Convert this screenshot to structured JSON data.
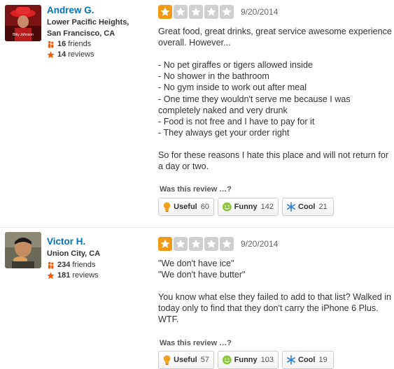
{
  "reviews": [
    {
      "user": {
        "name": "Andrew G.",
        "location": "Lower Pacific Heights, San Francisco, CA",
        "friends": "16",
        "friends_label": "friends",
        "reviews": "14",
        "reviews_label": "reviews",
        "avatar_text": "Biky Johnson"
      },
      "rating": 1,
      "date": "9/20/2014",
      "text": "Great food, great drinks, great service awesome experience overall. However...\n\n- No pet giraffes or tigers allowed inside\n- No shower in the bathroom\n- No gym inside to work out after meal\n- One time they wouldn't serve me because I was completely naked and very drunk\n- Food is not free and I have to pay for it\n- They always get your order right\n\nSo for these reasons I hate this place and will not return for a day or two.",
      "prompt": "Was this review …?",
      "votes": {
        "useful_label": "Useful",
        "useful": "60",
        "funny_label": "Funny",
        "funny": "142",
        "cool_label": "Cool",
        "cool": "21"
      }
    },
    {
      "user": {
        "name": "Victor H.",
        "location": "Union City, CA",
        "friends": "234",
        "friends_label": "friends",
        "reviews": "181",
        "reviews_label": "reviews"
      },
      "rating": 1,
      "date": "9/20/2014",
      "text": "\"We don't have ice\"\n\"We don't have butter\"\n\nYou know what else they failed to add to that list? Walked in today only to find that they don't carry the iPhone 6 Plus. WTF.",
      "prompt": "Was this review …?",
      "votes": {
        "useful_label": "Useful",
        "useful": "57",
        "funny_label": "Funny",
        "funny": "103",
        "cool_label": "Cool",
        "cool": "19"
      }
    }
  ],
  "colors": {
    "link": "#0073bb",
    "star_on": "#f09a17",
    "star_off": "#cfcfcf"
  }
}
